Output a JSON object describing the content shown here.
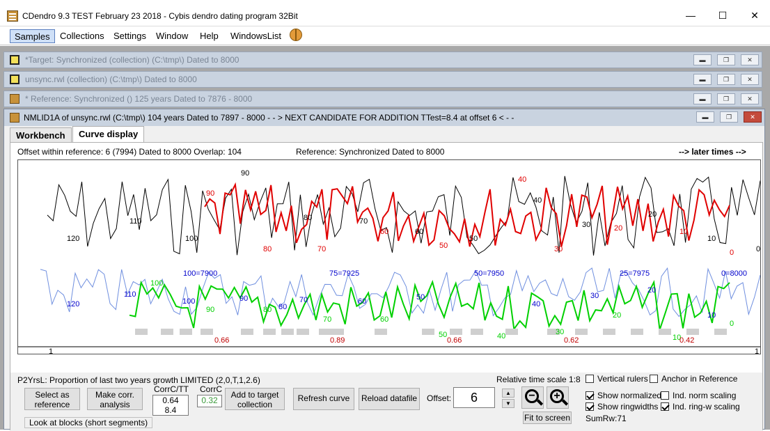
{
  "window": {
    "title": "CDendro 9.3  TEST February 23 2018 - Cybis dendro dating program  32Bit",
    "minimize": "—",
    "maximize": "☐",
    "close": "✕"
  },
  "menu": [
    "Samples",
    "Collections",
    "Settings",
    "Window",
    "Help",
    "WindowsList"
  ],
  "mdi_windows": [
    {
      "title": "*Target: Synchronized (collection)  (C:\\tmp\\)  Dated to 8000",
      "icon": "yellow-square-icon"
    },
    {
      "title": "unsync.rwl (collection)  (C:\\tmp\\)  Dated to 8000",
      "icon": "yellow-square-icon"
    },
    {
      "title": " * Reference: Synchronized    ()  125 years  Dated to 7876 - 8000",
      "icon": "tree-ring-icon"
    }
  ],
  "active_window": {
    "title": "NMLID1A of unsync.rwl    (C:\\tmp\\)  104 years  Dated to 7897 - 8000   - - >    NEXT CANDIDATE FOR ADDITION  TTest=8.4 at offset 6    < - -",
    "tabs": [
      "Workbench",
      "Curve display"
    ],
    "selected_tab": "Curve display",
    "info": "Offset within reference:   6  (7994)   Dated to 8000  Overlap: 104",
    "reference_label": "Reference: Synchronized  Dated to 8000",
    "later_times": "--> later times -->",
    "p2_label": "P2YrsL: Proportion of last two years growth LIMITED (2,0,T,1,2.6)",
    "buttons": {
      "select_ref": "Select as reference",
      "make_corr": "Make corr. analysis",
      "add_target": "Add to target collection",
      "refresh": "Refresh curve",
      "reload": "Reload datafile",
      "fit": "Fit to screen"
    },
    "corr_tt_label": "CorrC/TT",
    "corr_value": "0.64",
    "tt_value": "8.4",
    "corrc_label": "CorrC",
    "corrc_value": "0.32",
    "offset_label": "Offset:",
    "offset_value": "6",
    "time_scale": "Relative time scale 1:8",
    "checkboxes": {
      "vertical_rulers": "Vertical rulers",
      "anchor_ref": "Anchor in Reference",
      "show_norm": "Show normalized",
      "ind_norm": "Ind. norm scaling",
      "show_ringwidths": "Show ringwidths",
      "ind_ringw": "Ind. ring-w scaling"
    },
    "sumrw": "SumRw:71",
    "blocks_label": "Look at blocks (short segments)"
  },
  "chart_data": {
    "type": "line",
    "colors": {
      "reference": "#000000",
      "sample": "#e00000",
      "ref_norm": "#6f8fdf",
      "sample_norm": "#00d000",
      "axis_label": "#0000cc",
      "block_corr": "#c00000"
    },
    "top_labels_black": [
      "120",
      "110",
      "100",
      "90",
      "80",
      "70",
      "60",
      "50",
      "40",
      "30",
      "20",
      "10",
      "0"
    ],
    "top_labels_red": [
      "90",
      "80",
      "70",
      "60",
      "50",
      "40",
      "30",
      "20",
      "10",
      "0"
    ],
    "year_marks": [
      "100=7900",
      "75=7925",
      "50=7950",
      "25=7975",
      "0=8000"
    ],
    "bottom_labels_blue": [
      "120",
      "110",
      "100",
      "90",
      "80",
      "70",
      "60",
      "50",
      "40",
      "30",
      "20",
      "10"
    ],
    "bottom_labels_green": [
      "100",
      "90",
      "80",
      "70",
      "60",
      "50",
      "40",
      "30",
      "20",
      "10",
      "0"
    ],
    "block_correlations": [
      "0.66",
      "0.89",
      "0.66",
      "0.62",
      "0.42"
    ],
    "scale_start": "1",
    "scale_end": "1"
  }
}
